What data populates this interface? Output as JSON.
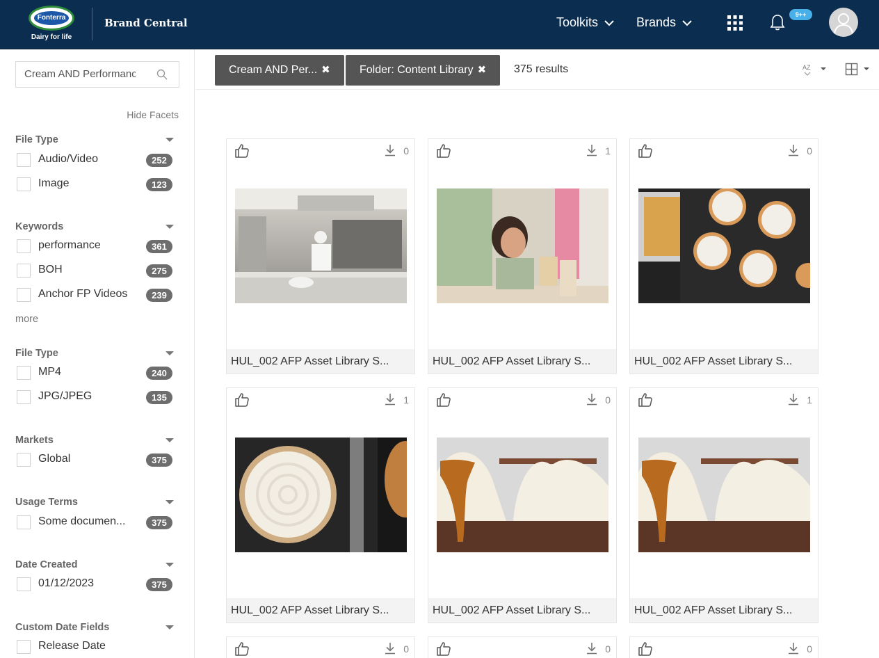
{
  "header": {
    "logo_text": "Fonterra",
    "logo_tagline": "Dairy for life",
    "app_title": "Brand Central",
    "nav": [
      {
        "label": "Toolkits"
      },
      {
        "label": "Brands"
      }
    ],
    "notification_badge": "9++"
  },
  "sidebar": {
    "search_value": "Cream AND Performance",
    "hide_facets_label": "Hide Facets",
    "more_label": "more",
    "facets": [
      {
        "title": "File Type",
        "items": [
          {
            "label": "Audio/Video",
            "count": "252"
          },
          {
            "label": "Image",
            "count": "123"
          }
        ]
      },
      {
        "title": "Keywords",
        "items": [
          {
            "label": "performance",
            "count": "361"
          },
          {
            "label": "BOH",
            "count": "275"
          },
          {
            "label": "Anchor FP Videos",
            "count": "239"
          }
        ]
      },
      {
        "title": "File Type",
        "items": [
          {
            "label": "MP4",
            "count": "240"
          },
          {
            "label": "JPG/JPEG",
            "count": "135"
          }
        ]
      },
      {
        "title": "Markets",
        "items": [
          {
            "label": "Global",
            "count": "375"
          }
        ]
      },
      {
        "title": "Usage Terms",
        "items": [
          {
            "label": "Some documen...",
            "count": "375"
          }
        ]
      },
      {
        "title": "Date Created",
        "items": [
          {
            "label": "01/12/2023",
            "count": "375"
          }
        ]
      },
      {
        "title": "Custom Date Fields",
        "items": [
          {
            "label": "Release Date",
            "count": ""
          }
        ]
      }
    ]
  },
  "filters": {
    "chips": [
      {
        "label": "Cream AND Per...",
        "remove": "✖"
      },
      {
        "label": "Folder: Content Library",
        "remove": "✖"
      }
    ],
    "results": "375 results",
    "sort_label": "AZ"
  },
  "colors": {
    "header_bg": "#0b2d4f",
    "chip_bg": "#555555",
    "badge_bg": "#6d6d6d",
    "notif_bg": "#48b0e8"
  },
  "assets": [
    {
      "caption": "HUL_002 AFP Asset Library S...",
      "downloads": "0",
      "thumb": "kitchen"
    },
    {
      "caption": "HUL_002 AFP Asset Library S...",
      "downloads": "1",
      "thumb": "girl-drink"
    },
    {
      "caption": "HUL_002 AFP Asset Library S...",
      "downloads": "0",
      "thumb": "tarts-tray"
    },
    {
      "caption": "HUL_002 AFP Asset Library S...",
      "downloads": "1",
      "thumb": "cream-tart"
    },
    {
      "caption": "HUL_002 AFP Asset Library S...",
      "downloads": "0",
      "thumb": "caramel-dessert"
    },
    {
      "caption": "HUL_002 AFP Asset Library S...",
      "downloads": "1",
      "thumb": "caramel-dessert"
    },
    {
      "caption": "",
      "downloads": "0",
      "thumb": ""
    },
    {
      "caption": "",
      "downloads": "0",
      "thumb": ""
    },
    {
      "caption": "",
      "downloads": "0",
      "thumb": ""
    }
  ]
}
